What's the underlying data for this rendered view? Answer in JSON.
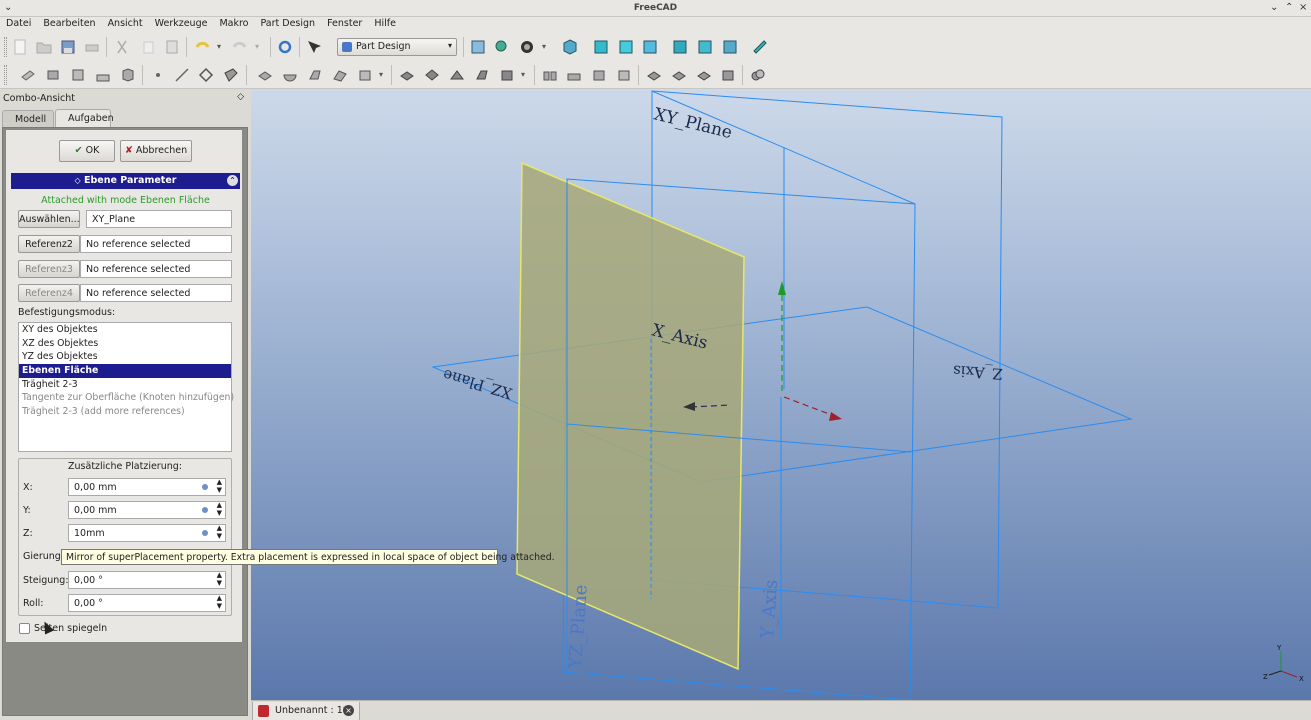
{
  "window": {
    "title": "FreeCAD",
    "controls": [
      "⌄",
      "⌃",
      "×"
    ]
  },
  "menu": [
    "Datei",
    "Bearbeiten",
    "Ansicht",
    "Werkzeuge",
    "Makro",
    "Part Design",
    "Fenster",
    "Hilfe"
  ],
  "toolbar": {
    "workbench": "Part Design"
  },
  "combo_view": {
    "title": "Combo-Ansicht",
    "tabs": [
      "Modell",
      "Aufgaben"
    ],
    "active_tab": "Aufgaben",
    "ok_label": "OK",
    "cancel_label": "Abbrechen",
    "section_title": "Ebene Parameter",
    "attached_status": "Attached with mode Ebenen Fläche",
    "references": [
      {
        "button": "Auswählen...",
        "value": "XY_Plane",
        "enabled": true
      },
      {
        "button": "Referenz2",
        "value": "No reference selected",
        "enabled": true
      },
      {
        "button": "Referenz3",
        "value": "No reference selected",
        "enabled": false
      },
      {
        "button": "Referenz4",
        "value": "No reference selected",
        "enabled": false
      }
    ],
    "mode_label": "Befestigungsmodus:",
    "modes": [
      {
        "label": "XY des Objektes",
        "state": "normal"
      },
      {
        "label": "XZ des Objektes",
        "state": "normal"
      },
      {
        "label": "YZ des Objektes",
        "state": "normal"
      },
      {
        "label": "Ebenen Fläche",
        "state": "selected"
      },
      {
        "label": "Trägheit 2-3",
        "state": "normal"
      },
      {
        "label": "Tangente zur Oberfläche (Knoten hinzufügen)",
        "state": "disabled"
      },
      {
        "label": "Trägheit 2-3 (add more references)",
        "state": "disabled"
      }
    ],
    "placement": {
      "title": "Zusätzliche Platzierung:",
      "x_label": "X:",
      "x_value": "0,00 mm",
      "y_label": "Y:",
      "y_value": "0,00 mm",
      "z_label": "Z:",
      "z_value": "10mm",
      "yaw_label": "Gierung:",
      "pitch_label": "Steigung:",
      "pitch_value": "0,00 °",
      "roll_label": "Roll:",
      "roll_value": "0,00 °"
    },
    "flip_label": "Seiten spiegeln",
    "flip_checked": false
  },
  "tooltip": "Mirror of superPlacement property. Extra placement is expressed in local space of object being attached.",
  "viewport": {
    "labels": {
      "xy_plane": "XY_Plane",
      "x_axis": "X_Axis",
      "yz_plane": "YZ_Plane",
      "y_axis": "Y_Axis",
      "xz_plane": "XZ_Plane",
      "z_axis": "Z_Axis"
    },
    "colors": {
      "plane_outline": "#2a8cf0",
      "selected_plane_fill": "#a7a878",
      "selected_plane_outline": "#e6e86a",
      "axis_green": "#1c9a2a",
      "axis_red": "#a0202a"
    }
  },
  "document_tab": "Unbenannt : 1*"
}
